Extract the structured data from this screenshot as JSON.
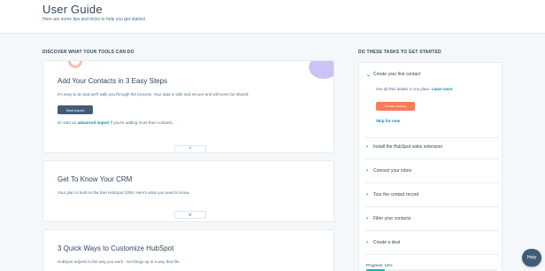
{
  "header": {
    "title": "User Guide",
    "subtitle": "Here are some tips and tricks to help you get started"
  },
  "left": {
    "section_label": "DISCOVER WHAT YOUR TOOLS CAN DO",
    "cards": [
      {
        "title": "Add Your Contacts in 3 Easy Steps",
        "text": "It's easy to do and we'll walk you through the process. Your data is safe and secure and will never be shared.",
        "button": "Start import",
        "alt_prefix": "Or start an",
        "alt_link": "advanced import",
        "alt_suffix": "if you're adding more than contacts.",
        "toggle": "^"
      },
      {
        "title": "Get To Know Your CRM",
        "text": "Your plan is built on the free HubSpot CRM. Here's what you need to know.",
        "toggle": "v"
      },
      {
        "title": "3 Quick Ways to Customize HubSpot",
        "text": "HubSpot adjusts to the way you work - set things up in a way that fits."
      }
    ]
  },
  "right": {
    "section_label": "DO THESE TASKS TO GET STARTED",
    "tasks": [
      {
        "label": "Create your first contact",
        "expanded": true,
        "detail": "See all their details in one place.",
        "detail_link": "Learn more",
        "button": "Create contact",
        "skip": "Skip for now"
      },
      {
        "label": "Install the HubSpot sales extension"
      },
      {
        "label": "Connect your inbox"
      },
      {
        "label": "Tour the contact record"
      },
      {
        "label": "Filter your contacts"
      },
      {
        "label": "Create a deal"
      }
    ],
    "progress_label": "Progress: 14%",
    "progress": 0.14
  },
  "help": {
    "label": "Help"
  },
  "colors": {
    "accent_blue": "#0091ae",
    "orange": "#ff7a59",
    "navy": "#425b76",
    "background": "#f5f8fa"
  }
}
